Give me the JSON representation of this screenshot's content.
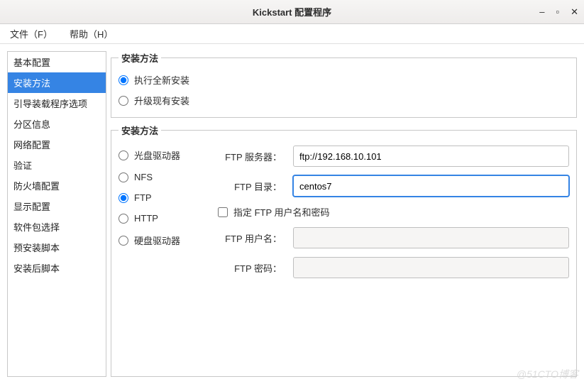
{
  "title": "Kickstart 配置程序",
  "menubar": {
    "file": "文件（F）",
    "help": "帮助（H）"
  },
  "sidebar": {
    "items": [
      "基本配置",
      "安装方法",
      "引导装载程序选项",
      "分区信息",
      "网络配置",
      "验证",
      "防火墙配置",
      "显示配置",
      "软件包选择",
      "预安装脚本",
      "安装后脚本"
    ],
    "selected_index": 1
  },
  "group1": {
    "legend": "安装方法",
    "options": {
      "fresh": "执行全新安装",
      "upgrade": "升级现有安装"
    },
    "selected": "fresh"
  },
  "group2": {
    "legend": "安装方法",
    "sources": {
      "cdrom": "光盘驱动器",
      "nfs": "NFS",
      "ftp": "FTP",
      "http": "HTTP",
      "hdd": "硬盘驱动器"
    },
    "selected": "ftp",
    "fields": {
      "server_label": "FTP 服务器：",
      "server_value": "ftp://192.168.10.101",
      "dir_label": "FTP 目录：",
      "dir_value": "centos7",
      "auth_checkbox": "指定 FTP 用户名和密码",
      "auth_checked": false,
      "user_label": "FTP 用户名：",
      "user_value": "",
      "pass_label": "FTP 密码：",
      "pass_value": ""
    }
  },
  "watermark": "@51CTO博客"
}
